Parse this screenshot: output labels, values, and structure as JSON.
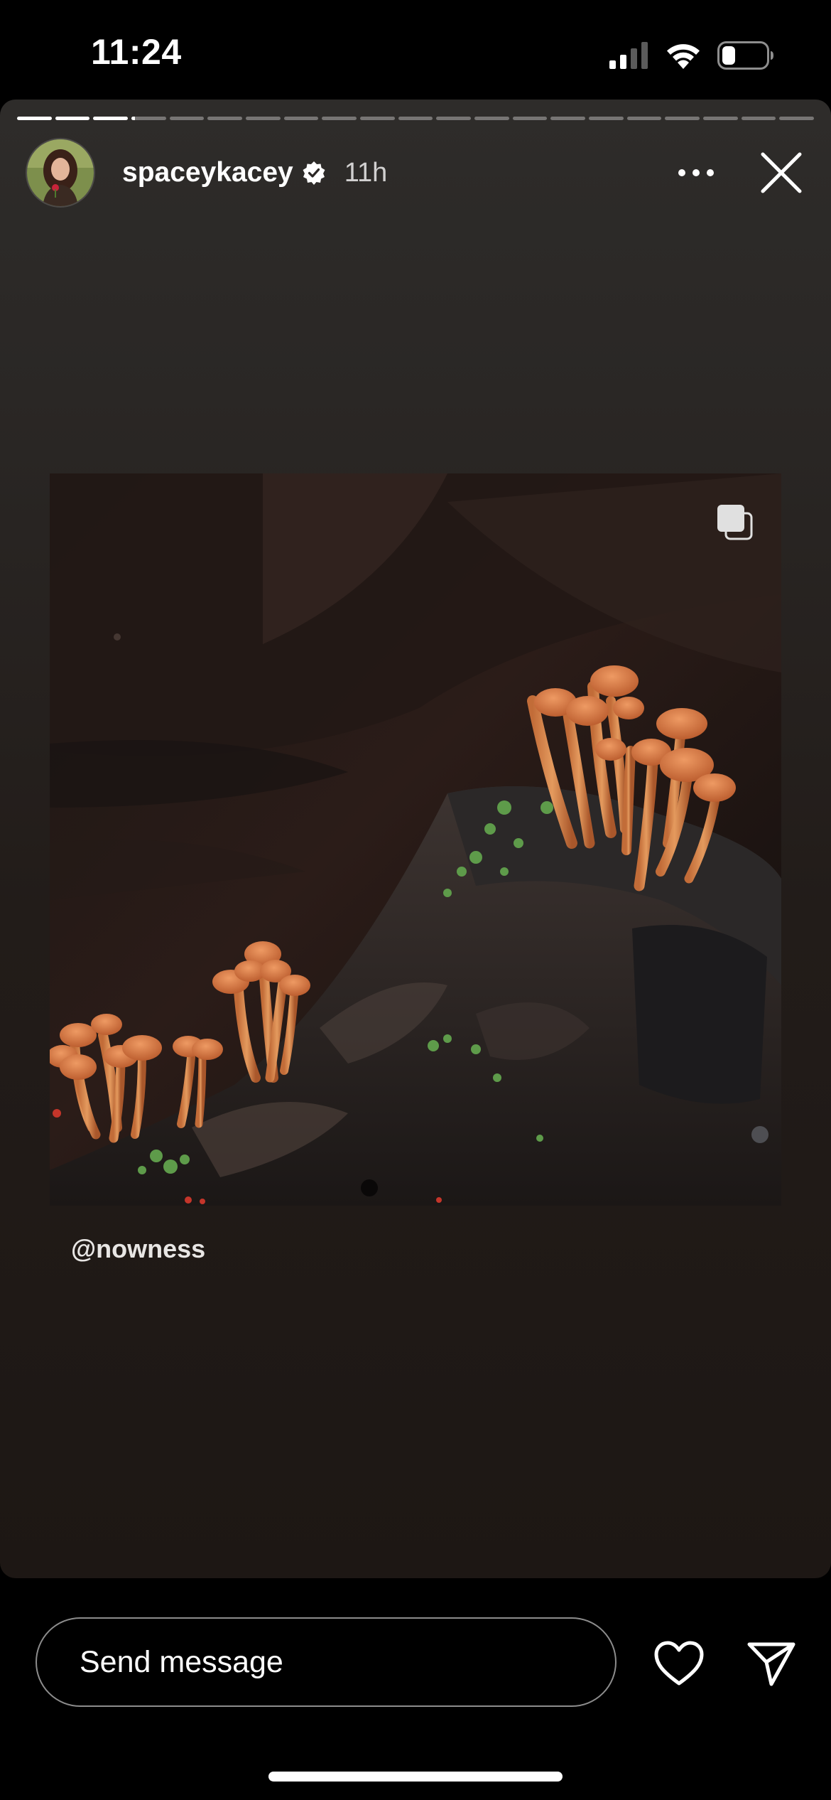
{
  "status_bar": {
    "time": "11:24",
    "icons": [
      "cellular-signal-icon",
      "wifi-icon",
      "battery-icon"
    ],
    "battery_level": 0.3
  },
  "story": {
    "segment_count": 21,
    "current_segment": 4,
    "username": "spaceykacey",
    "verified": true,
    "time_ago": "11h",
    "more_icon": "more-horizontal-icon",
    "close_icon": "close-icon",
    "post": {
      "multi_image": true
    },
    "mention": "@nowness"
  },
  "reply_bar": {
    "placeholder": "Send message",
    "like_icon": "heart-icon",
    "share_icon": "send-icon"
  }
}
